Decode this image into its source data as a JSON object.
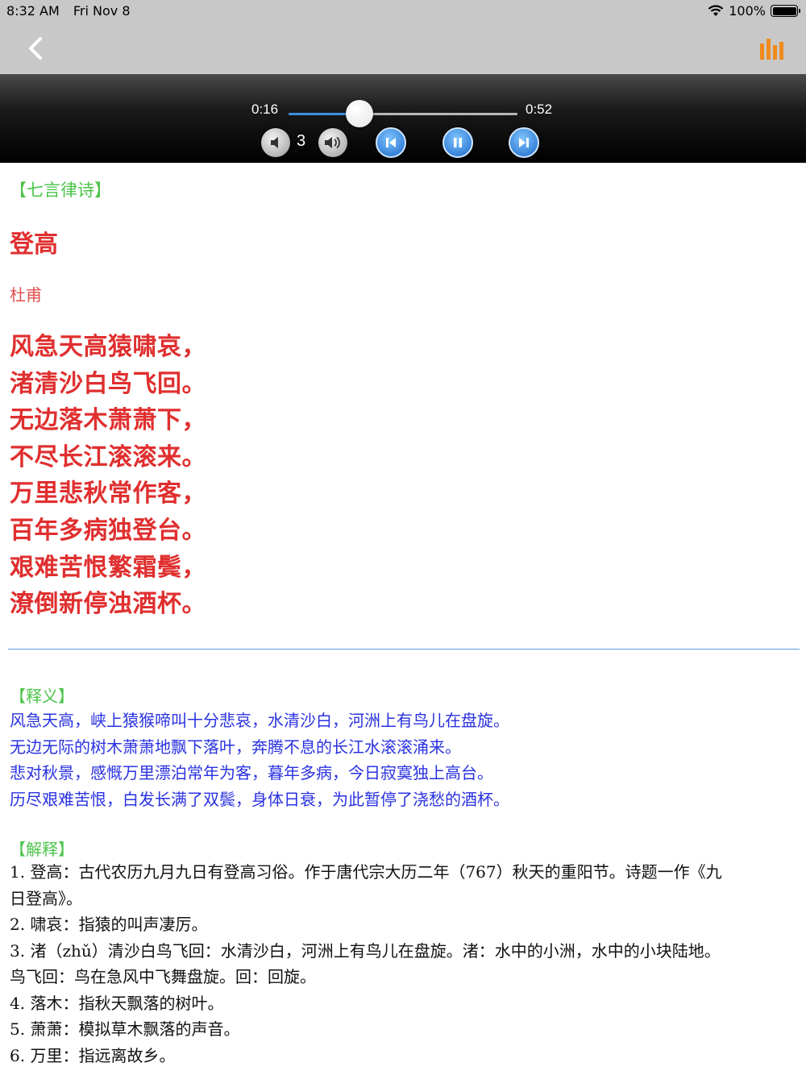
{
  "status_bar": {
    "time": "8:32 AM",
    "date": "Fri Nov 8",
    "battery": "100%",
    "battery_level": 1.0
  },
  "nav": {
    "back_icon": "chevron-left-icon",
    "playlist_icon": "bars-icon",
    "accent_color": "#f08a1c"
  },
  "player": {
    "elapsed": "0:16",
    "total": "0:52",
    "progress": 0.31,
    "volume_level": "3",
    "accent_color": "#3b8fe0"
  },
  "poem": {
    "genre": "【七言律诗】",
    "title": "登高",
    "author": "杜甫",
    "lines": [
      "风急天高猿啸哀，",
      "渚清沙白鸟飞回。",
      "无边落木萧萧下，",
      "不尽长江滚滚来。",
      "万里悲秋常作客，",
      "百年多病独登台。",
      "艰难苦恨繁霜鬓，",
      "潦倒新停浊酒杯。"
    ],
    "color": "#e02f2f"
  },
  "meaning": {
    "label": "【释义】",
    "lines": [
      "风急天高，峡上猿猴啼叫十分悲哀，水清沙白，河洲上有鸟儿在盘旋。",
      "无边无际的树木萧萧地飘下落叶，奔腾不息的长江水滚滚涌来。",
      "悲对秋景，感慨万里漂泊常年为客，暮年多病，今日寂寞独上高台。",
      "历尽艰难苦恨，白发长满了双鬓，身体日衰，为此暂停了浇愁的酒杯。"
    ],
    "color": "#2a32e0"
  },
  "notes": {
    "label": "【解释】",
    "lines": [
      "1. 登高：古代农历九月九日有登高习俗。作于唐代宗大历二年（767）秋天的重阳节。诗题一作《九",
      "日登高》。",
      "2. 啸哀：指猿的叫声凄厉。",
      "3. 渚（zhǔ）清沙白鸟飞回：水清沙白，河洲上有鸟儿在盘旋。渚：水中的小洲，水中的小块陆地。",
      "鸟飞回：鸟在急风中飞舞盘旋。回：回旋。",
      "4. 落木：指秋天飘落的树叶。",
      "5. 萧萧：模拟草木飘落的声音。",
      "6. 万里：指远离故乡。"
    ]
  }
}
